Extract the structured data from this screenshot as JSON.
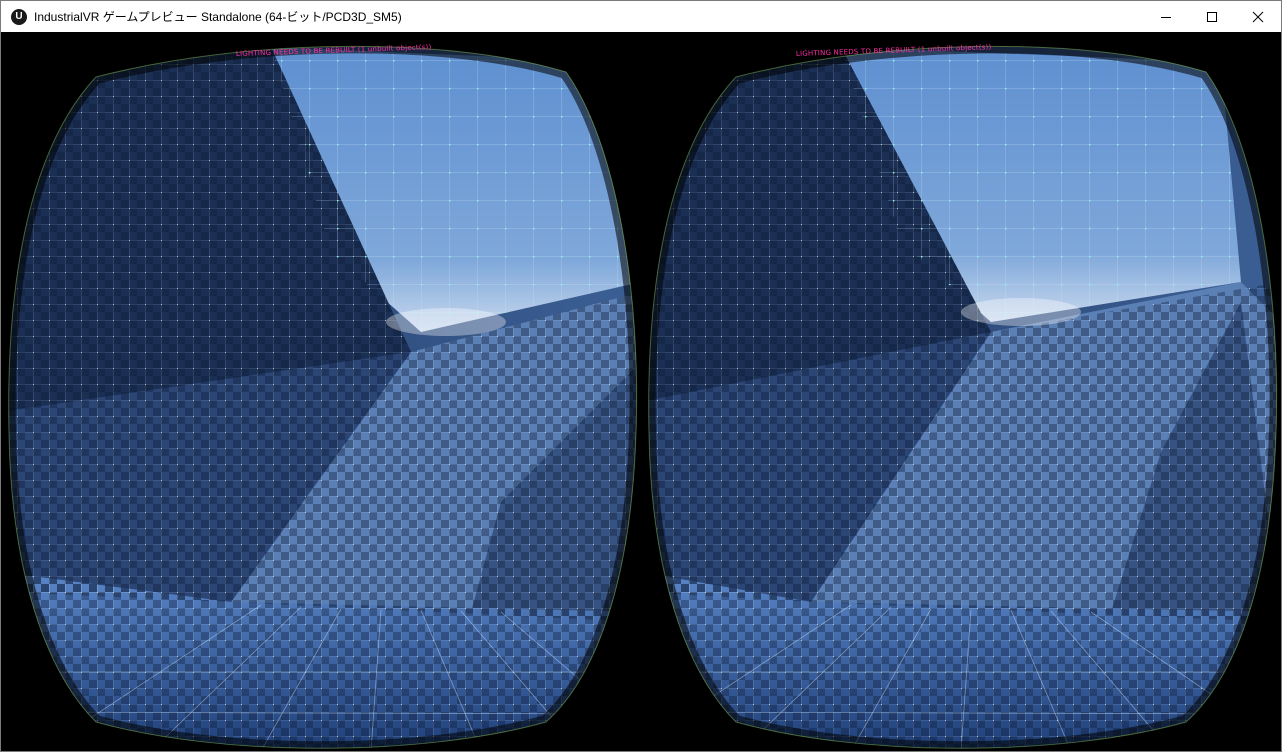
{
  "window": {
    "title": "IndustrialVR ゲームプレビュー Standalone (64-ビット/PCD3D_SM5)",
    "app_icon_glyph": "U"
  },
  "controls": {
    "minimize_icon": "minimize-icon",
    "maximize_icon": "maximize-icon",
    "close_icon": "close-icon"
  },
  "viewport": {
    "warning_text": "LIGHTING NEEDS TO BE REBUILT (1 unbuilt object(s))",
    "colors": {
      "ceiling": "#6f9fd6",
      "wall_lit": "#5d84b8",
      "wall_shadow": "#1d3358",
      "floor": "#2d5a9e",
      "grid_line": "#c9e4ff",
      "warning": "#ff2fa8"
    }
  }
}
